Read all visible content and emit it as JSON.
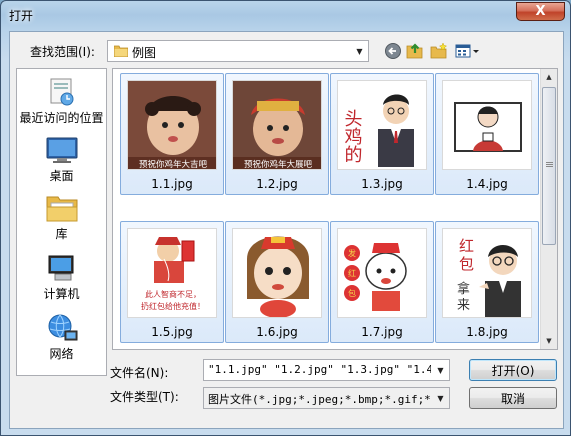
{
  "window": {
    "title": "打开",
    "close_label": "X"
  },
  "lookin": {
    "label": "查找范围(I):",
    "value": "例图"
  },
  "places": [
    {
      "label": "最近访问的位置",
      "icon": "recent-places-icon"
    },
    {
      "label": "桌面",
      "icon": "desktop-icon"
    },
    {
      "label": "库",
      "icon": "libraries-icon"
    },
    {
      "label": "计算机",
      "icon": "computer-icon"
    },
    {
      "label": "网络",
      "icon": "network-icon"
    }
  ],
  "files": [
    {
      "name": "1.1.jpg",
      "thumb_text": "预祝你鸡年大吉吧"
    },
    {
      "name": "1.2.jpg",
      "thumb_text": "预祝你鸡年大展吧"
    },
    {
      "name": "1.3.jpg",
      "thumb_text": "头鸡的"
    },
    {
      "name": "1.4.jpg",
      "thumb_text": ""
    },
    {
      "name": "1.5.jpg",
      "thumb_text": "此人智商不足，扔红包给他充值！"
    },
    {
      "name": "1.6.jpg",
      "thumb_text": ""
    },
    {
      "name": "1.7.jpg",
      "thumb_text": "发红包"
    },
    {
      "name": "1.8.jpg",
      "thumb_text": "红包拿来"
    }
  ],
  "filename": {
    "label": "文件名(N):",
    "value": "\"1.1.jpg\" \"1.2.jpg\" \"1.3.jpg\" \"1.4.jp"
  },
  "filetype": {
    "label": "文件类型(T):",
    "value": "图片文件(*.jpg;*.jpeg;*.bmp;*.gif;*.p"
  },
  "buttons": {
    "open": "打开(O)",
    "cancel": "取消"
  },
  "colors": {
    "selection": "#dbe9f9",
    "selection_border": "#84acdd",
    "close_red": "#c0432a"
  }
}
